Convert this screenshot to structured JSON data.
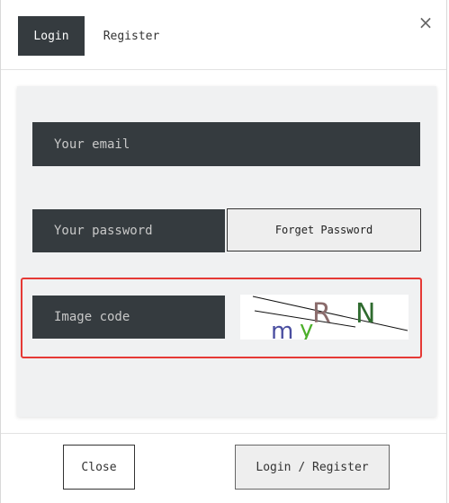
{
  "header": {
    "tabs": [
      {
        "label": "Login",
        "active": true
      },
      {
        "label": "Register",
        "active": false
      }
    ],
    "close_symbol": "×"
  },
  "form": {
    "email_placeholder": "Your email",
    "password_placeholder": "Your password",
    "forget_password_label": "Forget Password",
    "image_code_placeholder": "Image code",
    "captcha_text": "myRN"
  },
  "footer": {
    "close_label": "Close",
    "submit_label": "Login / Register"
  },
  "colors": {
    "dark_field": "#353b3f",
    "highlight": "#e53935",
    "captcha_r": "#8a6b6b",
    "captcha_n": "#2f6b2f",
    "captcha_m": "#4a4ea0",
    "captcha_y": "#4caf2a"
  }
}
